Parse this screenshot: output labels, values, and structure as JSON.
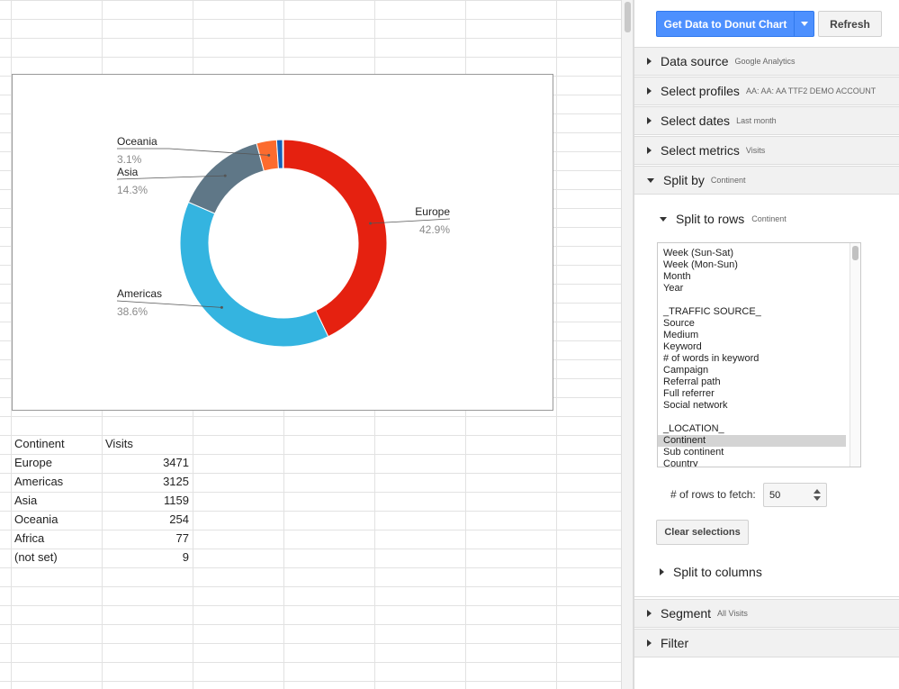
{
  "chart_data": {
    "type": "pie",
    "variant": "donut",
    "categories": [
      "Europe",
      "Americas",
      "Asia",
      "Oceania",
      "Africa",
      "(not set)"
    ],
    "values": [
      3471,
      3125,
      1159,
      254,
      77,
      9
    ],
    "percent_labels": [
      "42.9%",
      "38.6%",
      "14.3%",
      "3.1%"
    ],
    "labeled_slices": [
      "Europe",
      "Americas",
      "Asia",
      "Oceania"
    ],
    "colors": [
      "#e52110",
      "#34b4e0",
      "#5f7787",
      "#fc6b2e",
      "#1561b8",
      "#7e43a8"
    ],
    "legend": "leader-line labels"
  },
  "table": {
    "headers": [
      "Continent",
      "Visits"
    ],
    "rows": [
      [
        "Europe",
        "3471"
      ],
      [
        "Americas",
        "3125"
      ],
      [
        "Asia",
        "1159"
      ],
      [
        "Oceania",
        "254"
      ],
      [
        "Africa",
        "77"
      ],
      [
        "(not set)",
        "9"
      ]
    ]
  },
  "toolbar": {
    "primary_label": "Get Data to Donut Chart",
    "refresh_label": "Refresh"
  },
  "sections": {
    "data_source": {
      "title": "Data source",
      "sub": "Google Analytics"
    },
    "profiles": {
      "title": "Select profiles",
      "sub": "AA: AA: AA TTF2 DEMO ACCOUNT"
    },
    "dates": {
      "title": "Select dates",
      "sub": "Last month"
    },
    "metrics": {
      "title": "Select metrics",
      "sub": "Visits"
    },
    "split_by": {
      "title": "Split by",
      "sub": "Continent"
    },
    "segment": {
      "title": "Segment",
      "sub": "All Visits"
    },
    "filter": {
      "title": "Filter",
      "sub": ""
    }
  },
  "split": {
    "rows_title": "Split to rows",
    "rows_sub": "Continent",
    "columns_title": "Split to columns",
    "options": [
      "Week (Sun-Sat)",
      "Week (Mon-Sun)",
      "Month",
      "Year",
      "",
      "_TRAFFIC SOURCE_",
      "Source",
      "Medium",
      "Keyword",
      "# of words in keyword",
      "Campaign",
      "Referral path",
      "Full referrer",
      "Social network",
      "",
      "_LOCATION_",
      "Continent",
      "Sub continent",
      "Country"
    ],
    "selected": "Continent",
    "rows_to_fetch_label": "# of rows to fetch:",
    "rows_to_fetch_value": "50",
    "clear_label": "Clear selections"
  }
}
